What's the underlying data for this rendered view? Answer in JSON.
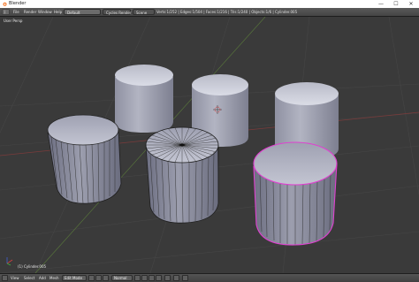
{
  "window": {
    "title": "Blender",
    "minimize": "—",
    "maximize": "☐",
    "close": "✕"
  },
  "menu": {
    "items": [
      "File",
      "Render",
      "Window",
      "Help"
    ],
    "layout": "Default",
    "scene": "Scene",
    "engine": "Cycles Render",
    "version": "v2.79",
    "stats": "Verts:1/252 | Edges:1/504 | Faces:1/216 | Tris:1/240 | Objects:1/6 | Cylinder.005"
  },
  "viewport": {
    "view_label": "User Persp",
    "object_label": "(1) Cylinder.005",
    "background": "#3a3a3a",
    "selection_color": "#e040d0"
  },
  "footer": {
    "menu": [
      "View",
      "Select",
      "Add",
      "Mesh"
    ],
    "mode": "Edit Mode",
    "pivot": "Normal",
    "shading": "Solid"
  }
}
